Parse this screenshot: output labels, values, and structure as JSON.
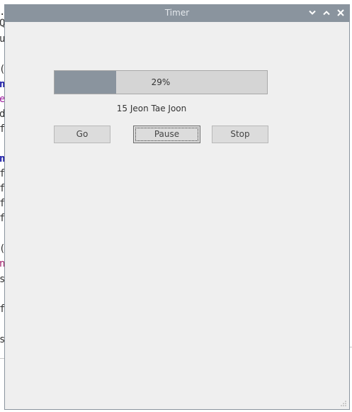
{
  "background": {
    "editor_glyphs": [
      {
        "char": ".",
        "color": "#333333"
      },
      {
        "char": "Q",
        "color": "#333333"
      },
      {
        "char": "u",
        "color": "#333333"
      },
      {
        "char": "(",
        "color": "#333333"
      },
      {
        "char": "n",
        "color": "#1a1aa6"
      },
      {
        "char": "e",
        "color": "#a020a0"
      },
      {
        "char": "d",
        "color": "#333333"
      },
      {
        "char": "f",
        "color": "#333333"
      },
      {
        "char": "n",
        "color": "#1a1aa6"
      },
      {
        "char": "f",
        "color": "#333333"
      },
      {
        "char": "f",
        "color": "#333333"
      },
      {
        "char": "f",
        "color": "#333333"
      },
      {
        "char": "f",
        "color": "#333333"
      },
      {
        "char": "(",
        "color": "#333333"
      },
      {
        "char": "n",
        "color": "#a0206a"
      },
      {
        "char": "s",
        "color": "#333333"
      },
      {
        "char": "f",
        "color": "#333333"
      },
      {
        "char": "s",
        "color": "#333333"
      }
    ]
  },
  "window": {
    "title": "Timer",
    "titlebar_color": "#8a949e",
    "controls": {
      "minimize": "chevron-down-icon",
      "maximize": "chevron-up-icon",
      "close": "close-icon"
    }
  },
  "progress": {
    "value_percent": 29,
    "text": "29%",
    "fill_color": "#8a949e"
  },
  "label": {
    "text": "15 Jeon Tae Joon"
  },
  "buttons": {
    "go": "Go",
    "pause": "Pause",
    "stop": "Stop"
  }
}
